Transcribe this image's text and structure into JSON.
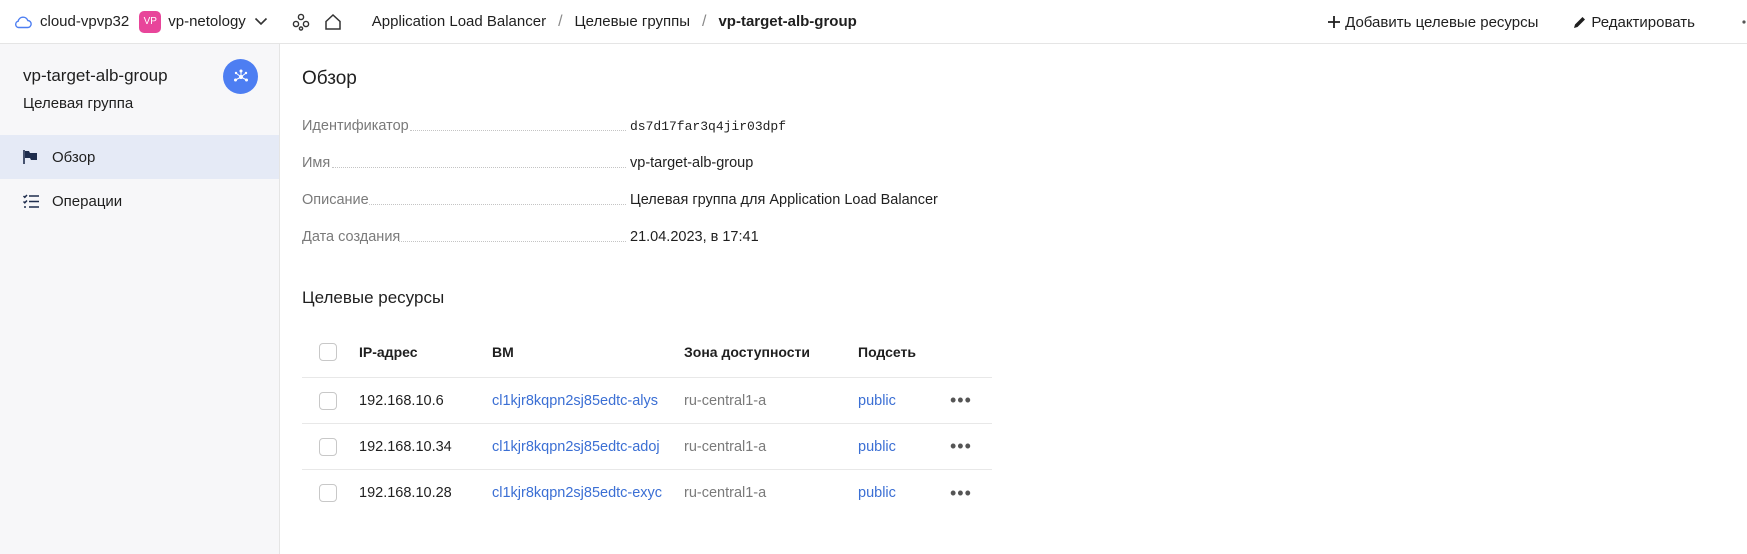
{
  "topbar": {
    "cloud": "cloud-vpvp32",
    "folder_badge": "VP",
    "folder": "vp-netology",
    "breadcrumbs": [
      "Application Load Balancer",
      "Целевые группы",
      "vp-target-alb-group"
    ],
    "separator": "/",
    "actions": {
      "add": "Добавить целевые ресурсы",
      "edit": "Редактировать"
    }
  },
  "sidebar": {
    "title": "vp-target-alb-group",
    "subtitle": "Целевая группа",
    "items": [
      {
        "label": "Обзор",
        "active": true,
        "icon": "flag-icon"
      },
      {
        "label": "Операции",
        "active": false,
        "icon": "list-icon"
      }
    ]
  },
  "overview": {
    "heading": "Обзор",
    "props": [
      {
        "label": "Идентификатор",
        "value": "ds7d17far3q4jir03dpf"
      },
      {
        "label": "Имя",
        "value": "vp-target-alb-group"
      },
      {
        "label": "Описание",
        "value": "Целевая группа для Application Load Balancer"
      },
      {
        "label": "Дата создания",
        "value": "21.04.2023, в 17:41"
      }
    ]
  },
  "targets": {
    "heading": "Целевые ресурсы",
    "columns": [
      "IP-адрес",
      "ВМ",
      "Зона доступности",
      "Подсеть"
    ],
    "rows": [
      {
        "ip": "192.168.10.6",
        "vm": "cl1kjr8kqpn2sj85edtc-alys",
        "zone": "ru-central1-a",
        "subnet": "public"
      },
      {
        "ip": "192.168.10.34",
        "vm": "cl1kjr8kqpn2sj85edtc-adoj",
        "zone": "ru-central1-a",
        "subnet": "public"
      },
      {
        "ip": "192.168.10.28",
        "vm": "cl1kjr8kqpn2sj85edtc-exyc",
        "zone": "ru-central1-a",
        "subnet": "public"
      }
    ],
    "menu_glyph": "•••"
  },
  "colors": {
    "accent": "#4d7ef2",
    "link": "#3b6fd4",
    "badge": "#e8459a",
    "active_bg": "#e5eaf6"
  }
}
